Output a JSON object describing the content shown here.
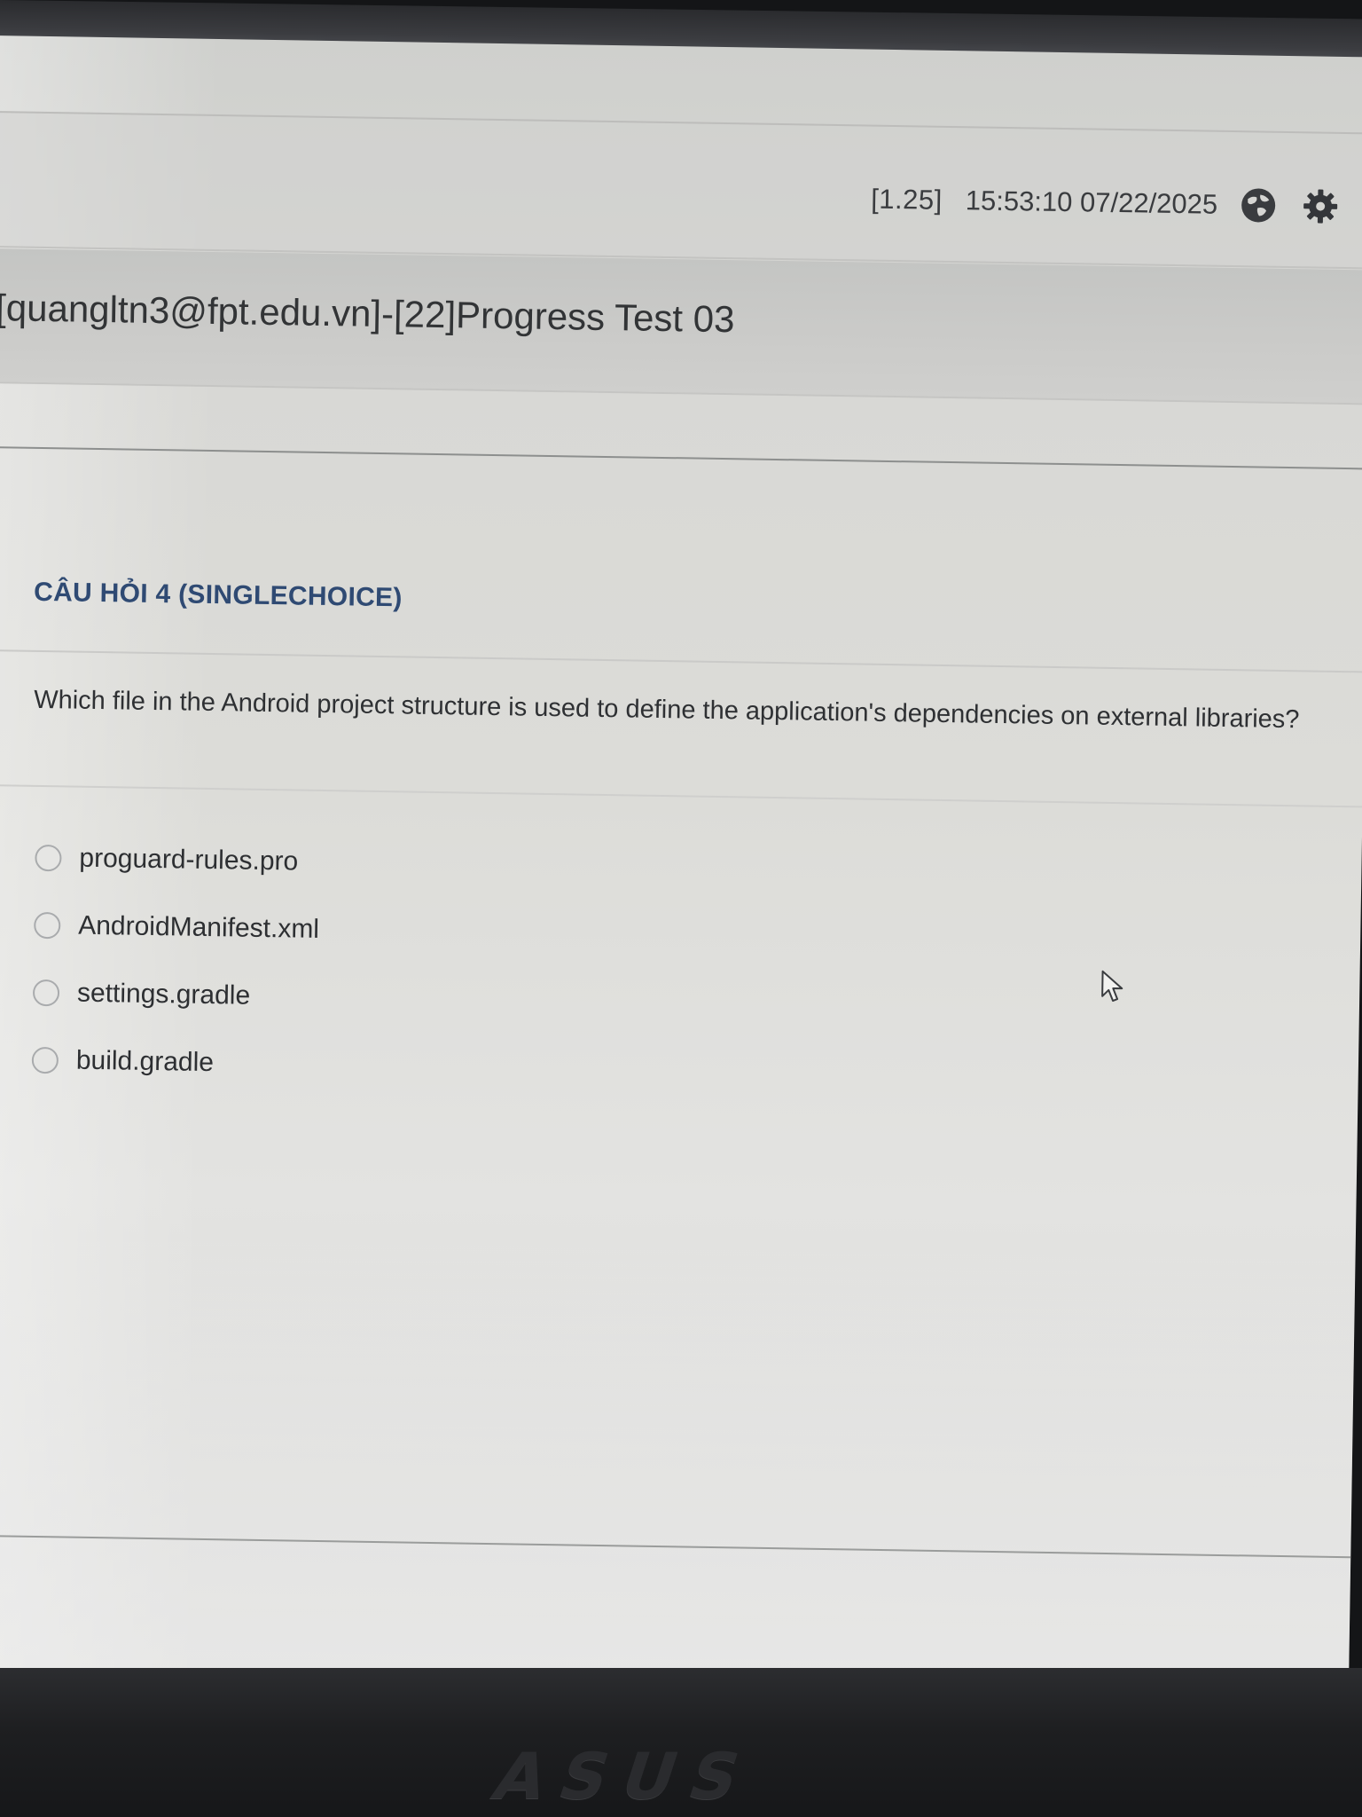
{
  "topbar": {
    "zoom_label": "[1.25]",
    "datetime": "15:53:10 07/22/2025",
    "icons": [
      "language-icon",
      "settings-gear-icon"
    ]
  },
  "exam": {
    "title": "[quangltn3@fpt.edu.vn]-[22]Progress Test 03"
  },
  "question": {
    "header": "CÂU HỎI 4 (SINGLECHOICE)",
    "text": "Which file in the Android project structure is used to define the application's dependencies on external libraries?",
    "options": [
      {
        "label": "proguard-rules.pro",
        "selected": false
      },
      {
        "label": "AndroidManifest.xml",
        "selected": false
      },
      {
        "label": "settings.gradle",
        "selected": false
      },
      {
        "label": "build.gradle",
        "selected": false
      }
    ]
  },
  "device": {
    "logo": "ASUS"
  },
  "colors": {
    "question_header": "#2f4a73",
    "text": "#2e3033",
    "screen_bg": "#dcdcd8"
  }
}
